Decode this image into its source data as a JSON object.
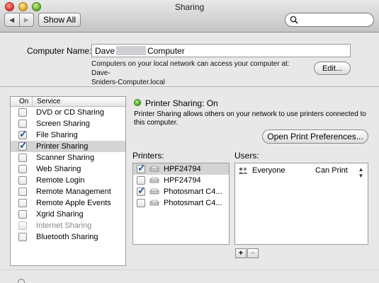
{
  "window": {
    "title": "Sharing"
  },
  "toolbar": {
    "show_all_label": "Show All",
    "back_glyph": "◀",
    "forward_glyph": "▶"
  },
  "search": {
    "placeholder": ""
  },
  "computer_name": {
    "label": "Computer Name:",
    "value_prefix": "Dave",
    "value_suffix": "Computer",
    "description_line1": "Computers on your local network can access your computer at: Dave-",
    "description_line2": "Sniders-Computer.local",
    "edit_button": "Edit..."
  },
  "services": {
    "header_on": "On",
    "header_service": "Service",
    "items": [
      {
        "label": "DVD or CD Sharing",
        "checked": false,
        "selected": false,
        "dim": false
      },
      {
        "label": "Screen Sharing",
        "checked": false,
        "selected": false,
        "dim": false
      },
      {
        "label": "File Sharing",
        "checked": true,
        "selected": false,
        "dim": false
      },
      {
        "label": "Printer Sharing",
        "checked": true,
        "selected": true,
        "dim": false
      },
      {
        "label": "Scanner Sharing",
        "checked": false,
        "selected": false,
        "dim": false
      },
      {
        "label": "Web Sharing",
        "checked": false,
        "selected": false,
        "dim": false
      },
      {
        "label": "Remote Login",
        "checked": false,
        "selected": false,
        "dim": false
      },
      {
        "label": "Remote Management",
        "checked": false,
        "selected": false,
        "dim": false
      },
      {
        "label": "Remote Apple Events",
        "checked": false,
        "selected": false,
        "dim": false
      },
      {
        "label": "Xgrid Sharing",
        "checked": false,
        "selected": false,
        "dim": false
      },
      {
        "label": "Internet Sharing",
        "checked": false,
        "selected": false,
        "dim": true
      },
      {
        "label": "Bluetooth Sharing",
        "checked": false,
        "selected": false,
        "dim": false
      }
    ]
  },
  "detail": {
    "status": "Printer Sharing: On",
    "status_color": "#3f9b1e",
    "description_line1": "Printer Sharing allows others on your network to use printers connected to",
    "description_line2": "this computer.",
    "open_print_prefs": "Open Print Preferences..."
  },
  "printers": {
    "label": "Printers:",
    "items": [
      {
        "name": "HPF24794",
        "checked": true,
        "selected": true
      },
      {
        "name": "HPF24794",
        "checked": false,
        "selected": false
      },
      {
        "name": "Photosmart C4...",
        "checked": true,
        "selected": false
      },
      {
        "name": "Photosmart C4...",
        "checked": false,
        "selected": false
      }
    ]
  },
  "users": {
    "label": "Users:",
    "items": [
      {
        "name": "Everyone",
        "permission": "Can Print",
        "stepper_glyph": "▲▼"
      }
    ],
    "add_glyph": "+",
    "remove_glyph": "−"
  },
  "colors": {
    "accent": "#1e4fa8",
    "selection": "#d4d4d4"
  }
}
